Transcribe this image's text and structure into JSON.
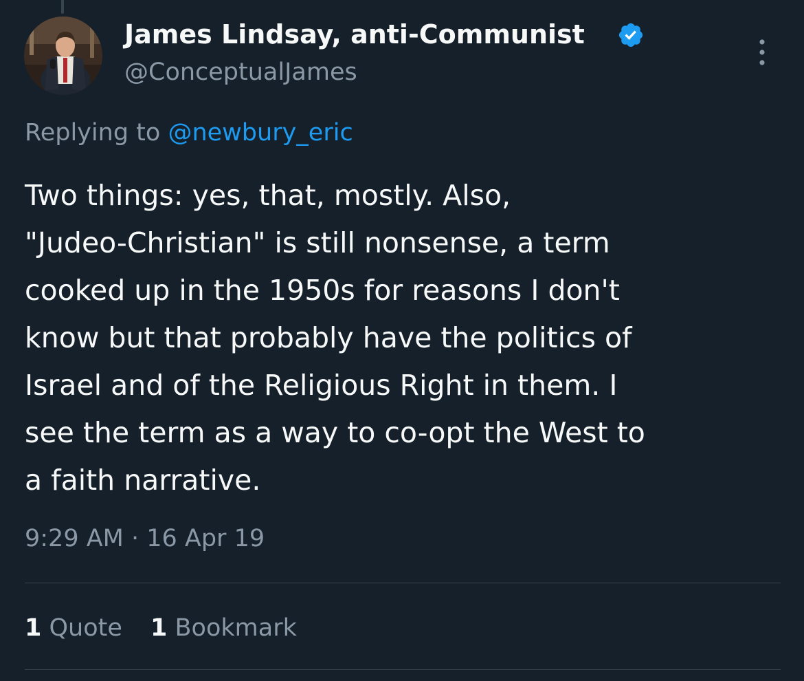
{
  "author": {
    "display_name": "James Lindsay, anti-Communist",
    "handle": "@ConceptualJames",
    "verified": true
  },
  "reply": {
    "prefix": "Replying to",
    "mention": "@newbury_eric"
  },
  "tweet": {
    "lines": [
      "Two things: yes, that, mostly. Also,",
      "\"Judeo-Christian\" is still nonsense, a term",
      "cooked up in the 1950s for reasons I don't",
      "know but that probably have the politics of",
      "Israel and of the Religious Right in them. I",
      "see the term as a way to co-opt the West to",
      "a faith narrative."
    ],
    "timestamp": "9:29 AM · 16 Apr 19"
  },
  "stats": {
    "quotes": {
      "count": "1",
      "label": "Quote"
    },
    "bookmarks": {
      "count": "1",
      "label": "Bookmark"
    }
  },
  "colors": {
    "background": "#15202b",
    "accent": "#1d9bf0",
    "secondary_text": "#8b98a5",
    "divider": "#38444d"
  },
  "icons": {
    "verified": "verified-badge-icon",
    "more": "more-options-icon"
  }
}
